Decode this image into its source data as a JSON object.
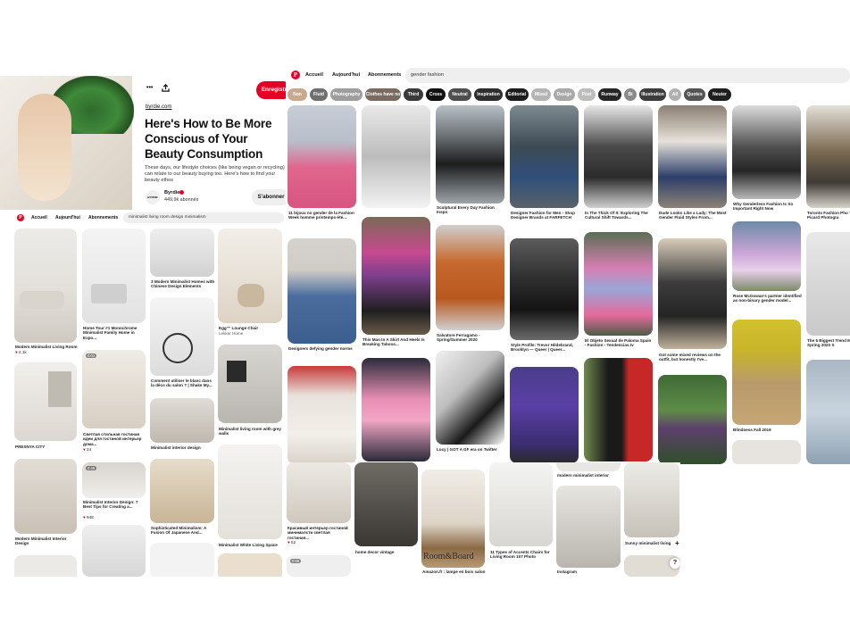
{
  "screen3": {
    "nav": {
      "home": "Accueil",
      "today": "Aujourd'hui",
      "subs": "Abonnements",
      "search": "gender fashion"
    },
    "chips": [
      {
        "label": "Non",
        "color": "#c9a98e"
      },
      {
        "label": "Fluid",
        "color": "#6f6f6f"
      },
      {
        "label": "Photography",
        "color": "#9e9e9e"
      },
      {
        "label": "Clothes have no",
        "color": "#7a6a60"
      },
      {
        "label": "Third",
        "color": "#3a3a3a"
      },
      {
        "label": "Cross",
        "color": "#111111"
      },
      {
        "label": "Neutral",
        "color": "#4e4e4e"
      },
      {
        "label": "Inspiration",
        "color": "#2e2e2e"
      },
      {
        "label": "Editorial",
        "color": "#1d1d1d"
      },
      {
        "label": "Mixed",
        "color": "#b5b5b5"
      },
      {
        "label": "Design",
        "color": "#a9a9a9"
      },
      {
        "label": "Post",
        "color": "#bdbdbd"
      },
      {
        "label": "Runway",
        "color": "#262626"
      },
      {
        "label": "Bi",
        "color": "#8a8a8a"
      },
      {
        "label": "Illustration",
        "color": "#3c3c3c"
      },
      {
        "label": "All",
        "color": "#b0b0b0"
      },
      {
        "label": "Quotes",
        "color": "#555555"
      },
      {
        "label": "Neuter",
        "color": "#1f1f1f"
      }
    ],
    "captions": {
      "c1": "11 bijoux no gender de la Fashion Week homme printemps-été...",
      "c2": "Sculptural Every Day Fashion Inspo",
      "c3": "Designer Fashion for Men - Shop Designer Brands at FARFETCH",
      "c4": "In The Thick Of It: Exploring The Cultural Shift Towards...",
      "c5": "Dude Looks Like a Lady: The Most Gender Fluid Styles From...",
      "c6": "Why Genderless Fashion Is So Important Right Now",
      "c7": "Toronto Fashion Pho Tina Picard Photogra",
      "c8": "Designers defying gender norms",
      "c9": "This Man In A Skirt And Heels Is Breaking Taboos...",
      "c10": "Salvatore Ferragamo - Spring/Summer 2020",
      "c11": "Style Profile: Trevor Hildebrand, Brooklyn — Queer | Queer...",
      "c12": "El Objeto Sexual de Paloma Spain - Fashion - Tendencias.tv",
      "c13": "Got some mixed reviews on the outfit, but honestly I've...",
      "c14": "Rose McGowan's partner identified as non-binary gender model...",
      "c15": "The 6 Biggest Trend Men's Spring 2020 S",
      "c16": "Blindness Fall 2019",
      "c17": "Lucy | GOT A GF era on Twitter"
    }
  },
  "screen2": {
    "nav": {
      "home": "Accueil",
      "today": "Aujourd'hui",
      "subs": "Abonnements",
      "search": "minimalist living room design minimalism"
    },
    "captions": {
      "a1": "Modern Minimalist Living Room",
      "a1meta": "2,1k",
      "a2": "Home Tour #1 Monochrome Minimalist Family Home in Expo...",
      "a3": "3 Modern Minimalist Homes with Chinese Design Elements",
      "a4": "Egg™ Lounge Chair",
      "a4sub": "Lekker Home",
      "a5": "Comment utiliser le blanc dans la déco du salon ? | Shake My...",
      "a6": "PRESNYA CITY",
      "a7": "Светлая стильная гостиная идеи для гостиной интерьер дома...",
      "a7meta": "24",
      "a8": "Minimalist interior design",
      "a9": "Minimalist living room with grey walls",
      "a10": "Modern Minimalist Interior Design",
      "a11": "Minimalist Interior Design: 7 Best Tips for Creating a...",
      "a11meta": "948",
      "a12": "Sophisticated Minimalism: A Fusion Of Japanese And...",
      "a13": "Minimalist White Living Space",
      "badge1": "0:01",
      "badge2": "0:46"
    }
  },
  "screen1": {
    "domain": "byrdie.com",
    "title": "Here's How to Be More Conscious of Your Beauty Consumption",
    "desc": "These days, our lifestyle choices (like being vegan or recycling) can relate to our beauty buying too. Here's how to find your beauty ethos",
    "author": "Byrdie",
    "followers": "449,9k abonnés",
    "save": "Enregistr",
    "follow": "S'abonner",
    "more": "•••"
  },
  "screen4": {
    "captions": {
      "b1": "Красивый интерьер гостиной минималсти светлая гостиная...",
      "b1meta": "52",
      "b2": "home decor vintage",
      "b3": "Amazon.fr : lampe en bois salon",
      "b3brand": "Room&Board",
      "b4": "11 Types of Accents Chairs for Living Room 107 Photo",
      "b5": "modern minimalist interior",
      "b6": "Instagram",
      "b7": "Sunny minimalist living",
      "badge": "0:56"
    },
    "help": "?",
    "plus": "+"
  }
}
